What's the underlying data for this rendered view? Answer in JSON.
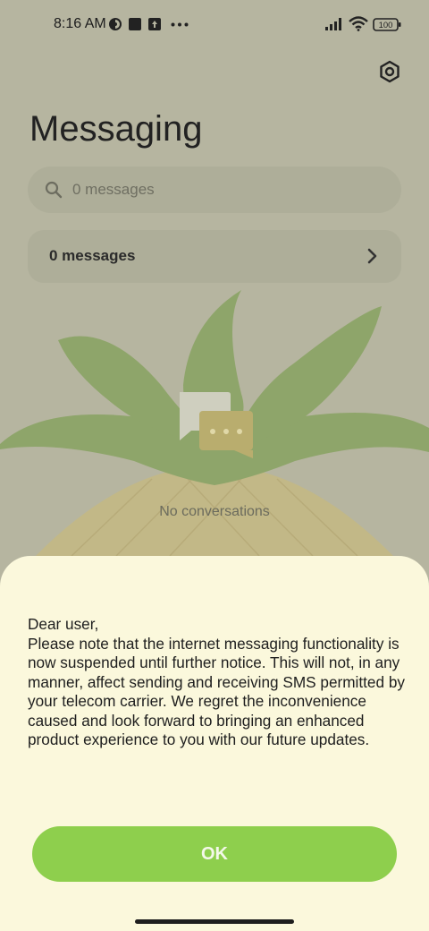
{
  "status_bar": {
    "time": "8:16 AM",
    "battery": "100",
    "icons": [
      "vpn-icon",
      "notification-square-icon",
      "upload-box-icon",
      "more-dots-icon",
      "signal-icon",
      "wifi-icon",
      "battery-icon"
    ]
  },
  "header": {
    "title": "Messaging",
    "settings_icon": "gear-icon"
  },
  "search": {
    "placeholder": "0 messages",
    "icon": "search-icon"
  },
  "messages_row": {
    "label": "0 messages",
    "icon": "chevron-right-icon"
  },
  "empty_state": {
    "label": "No conversations",
    "icon": "chat-bubbles-icon"
  },
  "dialog": {
    "greeting": "Dear user,",
    "body": "Please note that the internet messaging functionality is now suspended until further notice. This will not, in any manner, affect sending and receiving SMS permitted by your telecom carrier. We regret the inconvenience caused and look forward to bringing an enhanced product experience to you with our future updates.",
    "ok_label": "OK"
  },
  "colors": {
    "background_overlay": "#b6b5a0",
    "sheet": "#fbf8dc",
    "accent_green": "#8ecf4d",
    "leaf_green": "#8ea56a"
  }
}
